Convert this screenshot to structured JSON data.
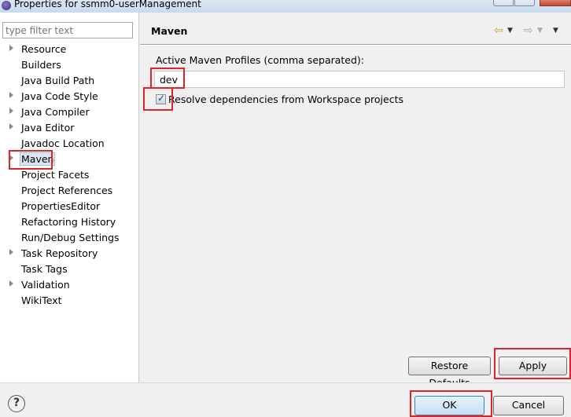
{
  "window": {
    "title": "Properties for ssmm0-userManagement",
    "app_icon": "eclipse-icon"
  },
  "sidebar": {
    "filter_placeholder": "type filter text",
    "items": [
      {
        "label": "Resource",
        "expandable": true
      },
      {
        "label": "Builders",
        "expandable": false
      },
      {
        "label": "Java Build Path",
        "expandable": false
      },
      {
        "label": "Java Code Style",
        "expandable": true
      },
      {
        "label": "Java Compiler",
        "expandable": true
      },
      {
        "label": "Java Editor",
        "expandable": true
      },
      {
        "label": "Javadoc Location",
        "expandable": false
      },
      {
        "label": "Maven",
        "expandable": true,
        "selected": true
      },
      {
        "label": "Project Facets",
        "expandable": false
      },
      {
        "label": "Project References",
        "expandable": false
      },
      {
        "label": "PropertiesEditor",
        "expandable": false
      },
      {
        "label": "Refactoring History",
        "expandable": false
      },
      {
        "label": "Run/Debug Settings",
        "expandable": false
      },
      {
        "label": "Task Repository",
        "expandable": true
      },
      {
        "label": "Task Tags",
        "expandable": false
      },
      {
        "label": "Validation",
        "expandable": true
      },
      {
        "label": "WikiText",
        "expandable": false
      }
    ]
  },
  "page": {
    "title": "Maven",
    "nav_icons": [
      "back-arrow-icon",
      "dropdown-icon",
      "forward-arrow-icon",
      "dropdown-icon",
      "view-menu-icon"
    ],
    "profiles_label": "Active Maven Profiles (comma separated):",
    "profiles_value": "dev",
    "resolve_checkbox_label": "Resolve dependencies from Workspace projects",
    "resolve_checked": true,
    "restore_defaults_label": "Restore Defaults",
    "apply_label": "Apply"
  },
  "footer": {
    "help_icon": "help-icon",
    "ok_label": "OK",
    "cancel_label": "Cancel"
  },
  "colors": {
    "annotation_red": "#e0242b",
    "selection_bg": "#dce7f4"
  }
}
